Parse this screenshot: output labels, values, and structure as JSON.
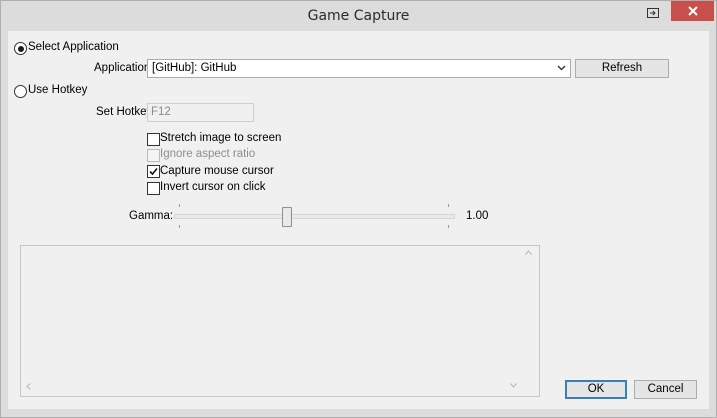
{
  "window": {
    "title": "Game Capture"
  },
  "source": {
    "select_application_label": "Select Application",
    "application_label": "Application:",
    "application_value": "[GitHub]: GitHub",
    "refresh_label": "Refresh",
    "use_hotkey_label": "Use Hotkey",
    "set_hotkey_label": "Set Hotkey",
    "hotkey_value": "F12",
    "selected_mode": "select_application"
  },
  "options": [
    {
      "label": "Stretch image to screen",
      "checked": false,
      "enabled": true
    },
    {
      "label": "Ignore aspect ratio",
      "checked": false,
      "enabled": false
    },
    {
      "label": "Capture mouse cursor",
      "checked": true,
      "enabled": true
    },
    {
      "label": "Invert cursor on click",
      "checked": false,
      "enabled": true
    }
  ],
  "gamma": {
    "label": "Gamma:",
    "value": "1.00",
    "level_fraction": 0.4
  },
  "buttons": {
    "ok_label": "OK",
    "cancel_label": "Cancel"
  },
  "icons": {
    "restore": "window-restore-icon",
    "close": "close-icon"
  },
  "colors": {
    "close_button": "#c7504d",
    "default_button_border": "#3c7fb1"
  }
}
